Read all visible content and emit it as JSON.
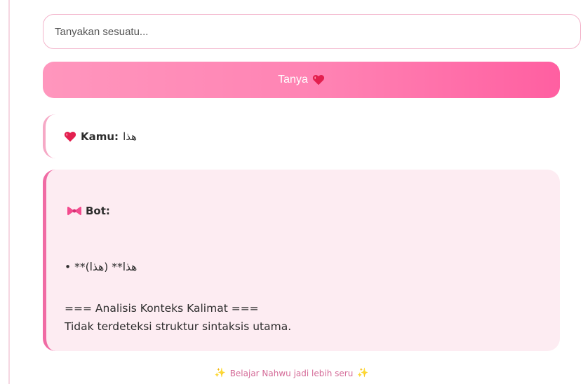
{
  "search": {
    "placeholder": "Tanyakan sesuatu...",
    "value": ""
  },
  "ask_button": {
    "label": "Tanya"
  },
  "chat": {
    "user": {
      "speaker": "Kamu:",
      "text": "هذا"
    },
    "bot": {
      "speaker": "Bot:",
      "line1": "• **(هذا) **هذا",
      "line2": "=== Analisis Konteks Kalimat ===",
      "line3": "Tidak terdeteksi struktur sintaksis utama."
    }
  },
  "footer": {
    "text": "Belajar Nahwu jadi lebih seru"
  },
  "icons": {
    "heart": "heart-icon",
    "bow": "ribbon-icon",
    "sparkle": "sparkle-fairy-icon"
  },
  "colors": {
    "accent_pink": "#ff82b3",
    "accent_dark": "#f06ba4",
    "bot_bg": "#fdecf2",
    "footer_text": "#d46a97"
  }
}
